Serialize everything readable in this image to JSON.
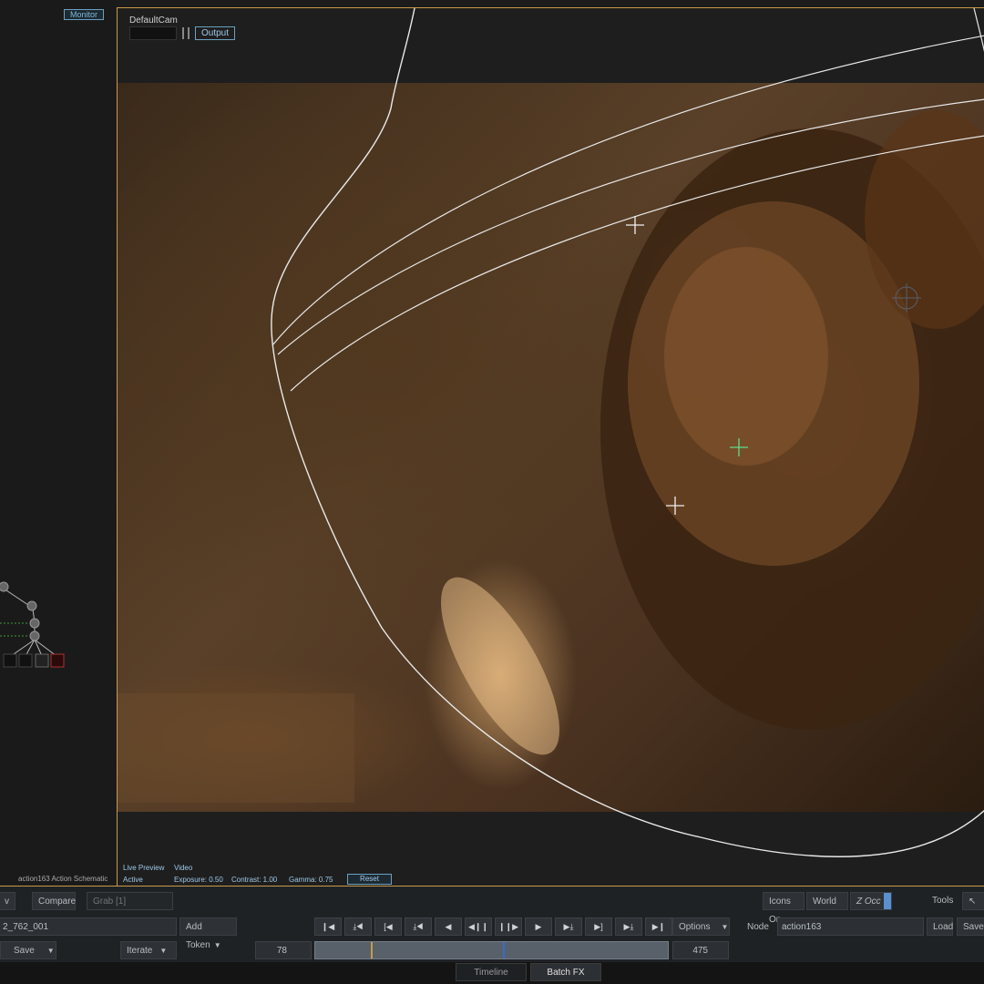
{
  "left_panel": {
    "monitor_label": "Monitor",
    "schematic_title": "action163 Action Schematic"
  },
  "viewer": {
    "camera_label": "DefaultCam",
    "output_label": "Output",
    "live_preview": "Live Preview",
    "video": "Video",
    "active": "Active",
    "exposure": "Exposure: 0.50",
    "contrast": "Contrast: 1.00",
    "gamma": "Gamma: 0.75",
    "reset_label": "Reset"
  },
  "toolbar_top": {
    "left_btn": "v",
    "compare": "Compare",
    "grab": "Grab [1]",
    "icons_on": "Icons On",
    "world": "World",
    "z_occ": "Z Occ",
    "tools": "Tools"
  },
  "toolbar_mid": {
    "clip_name": "2_762_001",
    "add_token": "Add Token",
    "options": "Options",
    "node_label": "Node",
    "node_value": "action163",
    "load": "Load",
    "save": "Save"
  },
  "toolbar_bottom": {
    "save": "Save",
    "iterate": "Iterate",
    "start_frame": "78",
    "end_frame": "475"
  },
  "tabs": [
    {
      "label": "Timeline"
    },
    {
      "label": "Batch FX"
    }
  ],
  "transport_icons": [
    "go-start-icon",
    "mark-in-icon",
    "in-bracket-icon",
    "prev-key-icon",
    "step-back-icon",
    "play-reverse-icon",
    "pause-icon",
    "play-icon",
    "next-key-icon",
    "out-bracket-icon",
    "mark-out-icon",
    "go-end-icon"
  ],
  "colors": {
    "accent": "#c79a4a",
    "highlight_blue": "#6aa0c0",
    "active_blue": "#5a8fd0"
  }
}
